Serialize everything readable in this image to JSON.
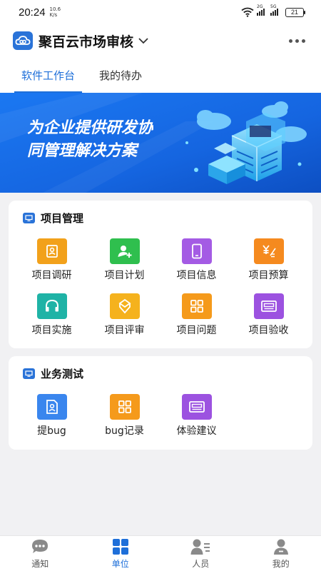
{
  "status_bar": {
    "time": "20:24",
    "speed_value": "10.6",
    "speed_unit": "K/s",
    "sim1_label": "2G",
    "sim2_label": "5G",
    "battery": "21"
  },
  "header": {
    "app_title": "聚百云市场审核"
  },
  "tabs": [
    {
      "label": "软件工作台",
      "active": true
    },
    {
      "label": "我的待办",
      "active": false
    }
  ],
  "banner": {
    "line1": "为企业提供研发协",
    "line2": "同管理解决方案"
  },
  "project_management": {
    "title": "项目管理",
    "items": [
      {
        "label": "项目调研",
        "color": "#f2a11b",
        "icon": "research-icon"
      },
      {
        "label": "项目计划",
        "color": "#2fbf4e",
        "icon": "user-plus-icon"
      },
      {
        "label": "项目信息",
        "color": "#a45be4",
        "icon": "phone-icon"
      },
      {
        "label": "项目预算",
        "color": "#f58a1f",
        "icon": "budget-icon"
      },
      {
        "label": "项目实施",
        "color": "#1fb3a6",
        "icon": "headset-icon"
      },
      {
        "label": "项目评审",
        "color": "#f5b21d",
        "icon": "review-icon"
      },
      {
        "label": "项目问题",
        "color": "#f59a1b",
        "icon": "grid-icon"
      },
      {
        "label": "项目验收",
        "color": "#9c52e0",
        "icon": "id-card-icon"
      }
    ]
  },
  "business_test": {
    "title": "业务测试",
    "items": [
      {
        "label": "提bug",
        "color": "#3a86ee",
        "icon": "doc-person-icon"
      },
      {
        "label": "bug记录",
        "color": "#f59a1b",
        "icon": "grid-icon"
      },
      {
        "label": "体验建议",
        "color": "#9c52e0",
        "icon": "id-card-icon"
      }
    ]
  },
  "bottom_nav": [
    {
      "label": "通知",
      "active": false
    },
    {
      "label": "单位",
      "active": true
    },
    {
      "label": "人员",
      "active": false
    },
    {
      "label": "我的",
      "active": false
    }
  ]
}
